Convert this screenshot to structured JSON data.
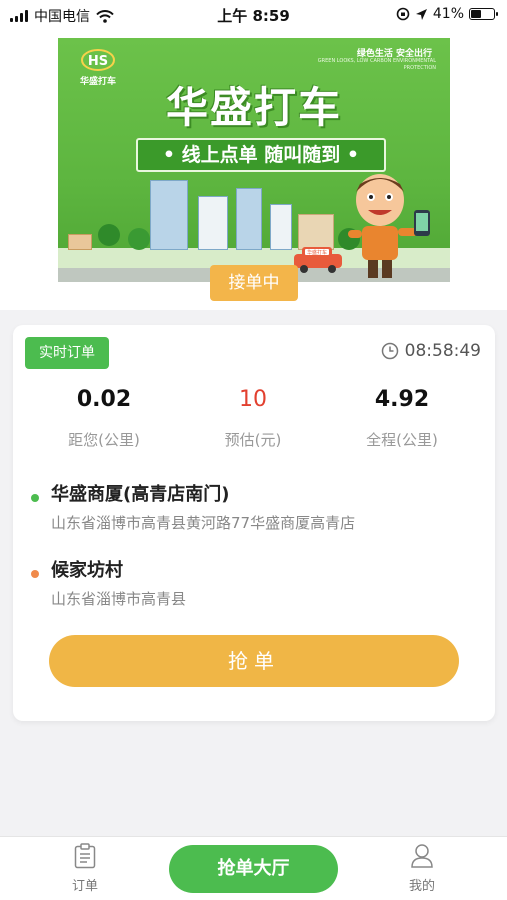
{
  "status_bar": {
    "carrier": "中国电信",
    "time": "上午 8:59",
    "battery_percent": "41%",
    "battery_level": 0.41
  },
  "banner": {
    "logo_text": "华盛打车",
    "slogan_cn": "绿色生活 安全出行",
    "slogan_en": "GREEN LOOKS, LOW CARBON ENVIRONMENTAL PROTECTION",
    "title": "华盛打车",
    "ribbon": "• 线上点单  随叫随到 •",
    "taxi_sign": "华盛打车"
  },
  "status_pill": "接单中",
  "order": {
    "tag": "实时订单",
    "time": "08:58:49",
    "stats": [
      {
        "value": "0.02",
        "label": "距您(公里)"
      },
      {
        "value": "10",
        "label": "预估(元)"
      },
      {
        "value": "4.92",
        "label": "全程(公里)"
      }
    ],
    "pickup": {
      "name": "华盛商厦(高青店南门)",
      "detail": "山东省淄博市高青县黄河路77华盛商厦高青店"
    },
    "dropoff": {
      "name": "候家坊村",
      "detail": "山东省淄博市高青县"
    },
    "button": "抢单"
  },
  "tabbar": {
    "orders": "订单",
    "hall": "抢单大厅",
    "mine": "我的"
  },
  "colors": {
    "green": "#4cbc4f",
    "orange": "#f0b646",
    "red_value": "#e2402f",
    "pickup_dot": "#4cbc4f",
    "dropoff_dot": "#f08a4b"
  }
}
